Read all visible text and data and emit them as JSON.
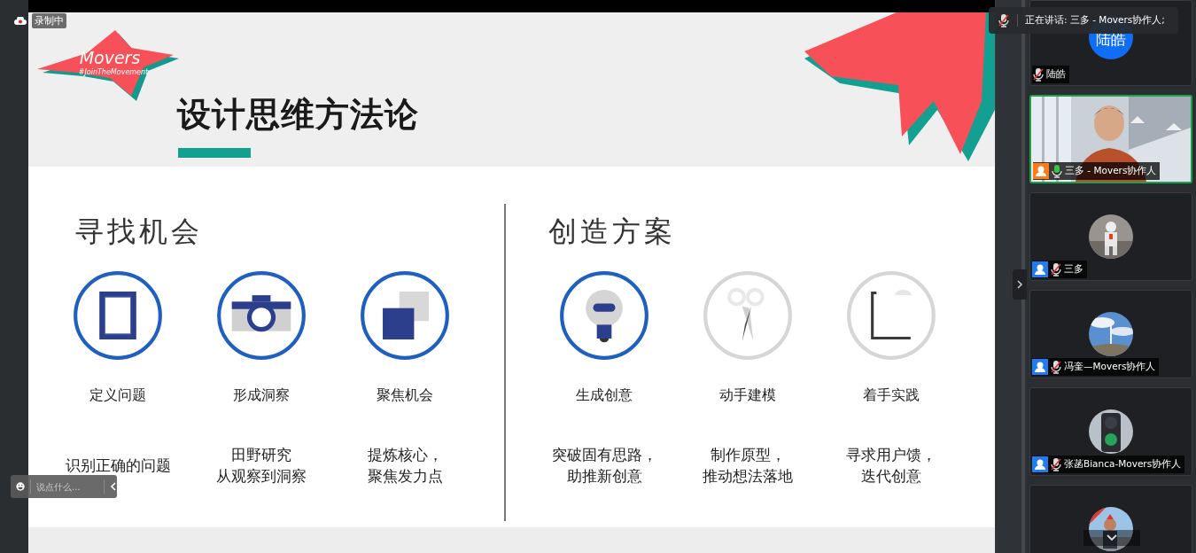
{
  "recording": {
    "label": "录制中"
  },
  "speaking_banner": {
    "text": "正在讲话: 三多 - Movers协作人;",
    "muted": true
  },
  "slide": {
    "logo": {
      "name": "Movers",
      "tagline": "#JoinTheMovement"
    },
    "title": "设计思维方法论",
    "sections": [
      {
        "heading": "寻找机会",
        "items": [
          {
            "kind": "frame",
            "highlighted": true,
            "label": "定义问题",
            "description": [
              "识别正确的问题"
            ]
          },
          {
            "kind": "camera",
            "highlighted": true,
            "label": "形成洞察",
            "description": [
              "田野研究",
              "从观察到洞察"
            ]
          },
          {
            "kind": "squares",
            "highlighted": true,
            "label": "聚焦机会",
            "description": [
              "提炼核心，",
              "聚焦发力点"
            ]
          }
        ]
      },
      {
        "heading": "创造方案",
        "items": [
          {
            "kind": "bulb",
            "highlighted": true,
            "label": "生成创意",
            "description": [
              "突破固有思路，",
              "助推新创意"
            ]
          },
          {
            "kind": "scissors",
            "highlighted": false,
            "label": "动手建模",
            "description": [
              "制作原型，",
              "推动想法落地"
            ]
          },
          {
            "kind": "bracket",
            "highlighted": false,
            "label": "着手实践",
            "description": [
              "寻求用户馈，",
              "迭代创意"
            ]
          }
        ]
      }
    ]
  },
  "chat": {
    "placeholder": "说点什么..."
  },
  "participants": [
    {
      "name": "陆皓",
      "kind": "initials",
      "avatar_text": "陆皓",
      "muted": true,
      "speaking": false
    },
    {
      "name": "三多 - Movers协作人",
      "kind": "video",
      "color": "#ff7a1a",
      "muted": false,
      "speaking": true
    },
    {
      "name": "三多",
      "kind": "robot",
      "color": "#1e7cf5",
      "muted": true,
      "speaking": false
    },
    {
      "name": "冯奎—Movers协作人",
      "kind": "turbine",
      "color": "#1e7cf5",
      "muted": true,
      "speaking": false
    },
    {
      "name": "张菡Bianca-Movers协作人",
      "kind": "traffic",
      "color": "#1e7cf5",
      "muted": true,
      "speaking": false
    },
    {
      "kind": "person",
      "speaking": false,
      "expand": true
    }
  ]
}
